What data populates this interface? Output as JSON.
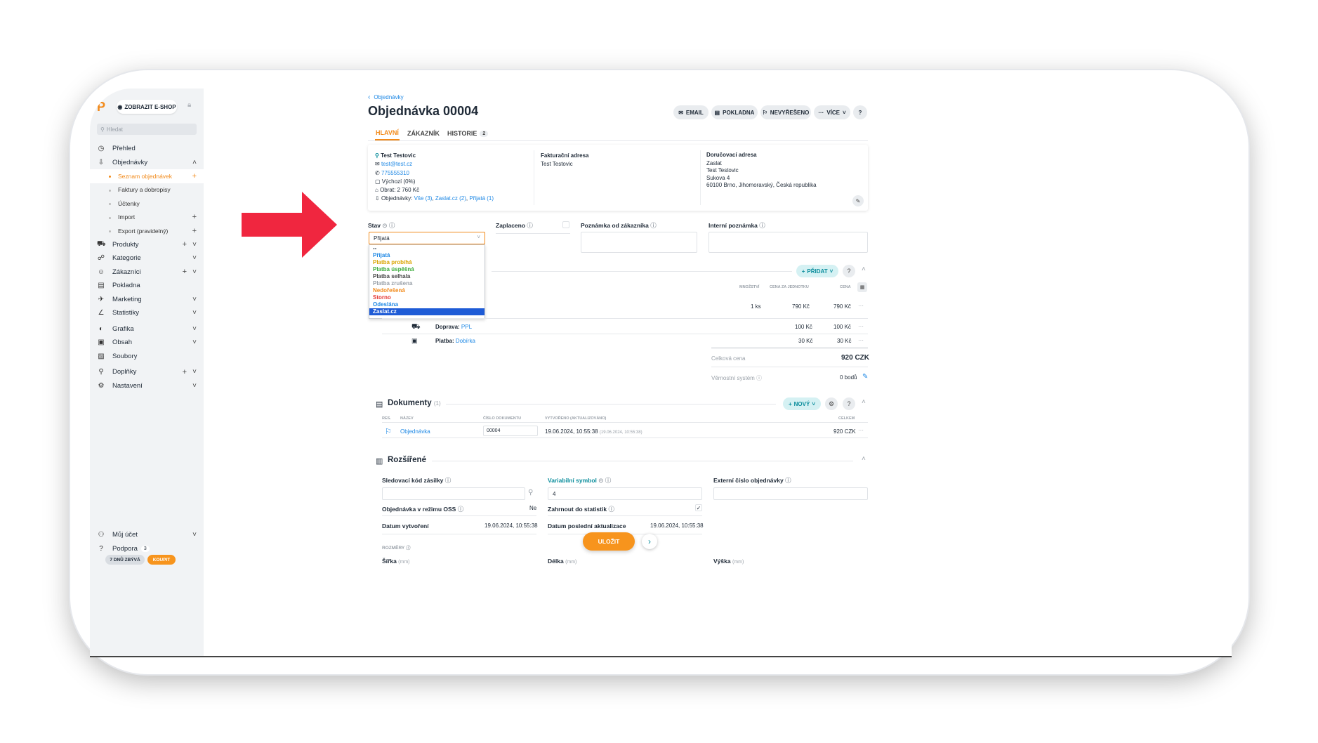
{
  "sidebar": {
    "logo": "P",
    "eshop_button": "ZOBRAZIT E-SHOP",
    "search_placeholder": "Hledat",
    "items": [
      {
        "icon": "dashboard-icon",
        "glyph": "◷",
        "label": "Přehled"
      },
      {
        "icon": "orders-icon",
        "glyph": "⇩",
        "label": "Objednávky",
        "chevron": "˄"
      },
      {
        "icon": "products-icon",
        "glyph": "⛟",
        "label": "Produkty",
        "plus": "+",
        "chevron": "˅"
      },
      {
        "icon": "categories-icon",
        "glyph": "☍",
        "label": "Kategorie",
        "chevron": "˅"
      },
      {
        "icon": "customers-icon",
        "glyph": "☺",
        "label": "Zákazníci",
        "plus": "+",
        "chevron": "˅"
      },
      {
        "icon": "cash-register-icon",
        "glyph": "▤",
        "label": "Pokladna"
      },
      {
        "icon": "marketing-icon",
        "glyph": "✈",
        "label": "Marketing",
        "chevron": "˅"
      },
      {
        "icon": "statistics-icon",
        "glyph": "∠",
        "label": "Statistiky",
        "chevron": "˅"
      },
      {
        "icon": "graphics-icon",
        "glyph": "◐",
        "label": "Grafika",
        "chevron": "˅"
      },
      {
        "icon": "content-icon",
        "glyph": "▣",
        "label": "Obsah",
        "chevron": "˅"
      },
      {
        "icon": "files-icon",
        "glyph": "▨",
        "label": "Soubory"
      },
      {
        "icon": "addons-icon",
        "glyph": "⚲",
        "label": "Doplňky",
        "plus": "+",
        "chevron": "˅"
      },
      {
        "icon": "settings-icon",
        "glyph": "⚙",
        "label": "Nastavení",
        "chevron": "˅"
      }
    ],
    "sub_items": [
      {
        "label": "Seznam objednávek",
        "plus": "+"
      },
      {
        "label": "Faktury a dobropisy"
      },
      {
        "label": "Účtenky"
      },
      {
        "label": "Import",
        "plus": "+"
      },
      {
        "label": "Export (pravidelný)",
        "plus": "+"
      }
    ],
    "account": {
      "label": "Můj účet",
      "chevron": "˅"
    },
    "support": {
      "label": "Podpora",
      "count": "3"
    },
    "days_left": "7 DNŮ ZBÝVÁ",
    "buy": "KOUPIT"
  },
  "header": {
    "breadcrumb": "Objednávky",
    "title": "Objednávka 00004",
    "buttons": {
      "email": "EMAIL",
      "pos": "POKLADNA",
      "unresolved": "NEVYŘEŠENO",
      "more": "VÍCE",
      "help": "?"
    },
    "tabs": [
      {
        "label": "HLAVNÍ"
      },
      {
        "label": "ZÁKAZNÍK"
      },
      {
        "label": "HISTORIE",
        "count": "2"
      }
    ]
  },
  "customer": {
    "name": "Test Testovic",
    "email": "test@test.cz",
    "phone": "775555310",
    "pricelist": "Výchozí (0%)",
    "turnover": "Obrat: 2 760 Kč",
    "orders_label": "Objednávky:",
    "orders_all": "Vše (3)",
    "orders_zaslat": "Zaslat.cz (2)",
    "orders_accepted": "Přijatá (1)"
  },
  "billing": {
    "title": "Fakturační adresa",
    "name": "Test Testovic"
  },
  "shipping": {
    "title": "Doručovací adresa",
    "lines": [
      "Zaslat",
      "Test Testovic",
      "Sukova 4",
      "60100 Brno, Jihomoravský, Česká republika"
    ]
  },
  "form": {
    "status_label": "Stav",
    "status_value": "Přijatá",
    "paid_label": "Zaplaceno",
    "customer_note_label": "Poznámka od zákazníka",
    "internal_note_label": "Interní poznámka"
  },
  "status_options": [
    {
      "label": "--",
      "color": "#1f2a37"
    },
    {
      "label": "Přijatá",
      "color": "#1e88e5"
    },
    {
      "label": "Platba probíhá",
      "color": "#d9a400"
    },
    {
      "label": "Platba úspěšná",
      "color": "#3bab3b"
    },
    {
      "label": "Platba selhala",
      "color": "#444444"
    },
    {
      "label": "Platba zrušena",
      "color": "#9aa1a9"
    },
    {
      "label": "Nedořešená",
      "color": "#f28a1a"
    },
    {
      "label": "Storno",
      "color": "#e53935"
    },
    {
      "label": "Odeslána",
      "color": "#1e88e5"
    },
    {
      "label": "Zaslat.cz",
      "color": "#ffffff",
      "selected": true
    }
  ],
  "items_section": {
    "add_button": "PŘIDAT",
    "help": "?",
    "columns": {
      "qty": "MNOŽSTVÍ",
      "unit_price": "CENA ZA JEDNOTKU",
      "price": "CENA"
    },
    "product": {
      "qty": "1 ks",
      "unit_price": "790 Kč",
      "price": "790 Kč"
    },
    "shipping": {
      "label": "Doprava:",
      "value": "PPL",
      "unit_price": "100 Kč",
      "price": "100 Kč"
    },
    "payment": {
      "label": "Platba:",
      "value": "Dobírka",
      "unit_price": "30 Kč",
      "price": "30 Kč"
    },
    "total_label": "Celková cena",
    "total_value": "920 CZK",
    "loyalty_label": "Věrnostní systém",
    "loyalty_value": "0 bodů",
    "more": "···"
  },
  "documents": {
    "title": "Dokumenty",
    "count": "(1)",
    "new_button": "NOVÝ",
    "help": "?",
    "columns": {
      "res": "RES.",
      "name": "NÁZEV",
      "doc_no": "ČÍSLO DOKUMENTU",
      "created": "VYTVOŘENO (AKTUALIZOVÁNO)",
      "total": "CELKEM"
    },
    "row": {
      "name": "Objednávka",
      "doc_no": "00004",
      "created": "19.06.2024, 10:55:38",
      "updated": "(19.06.2024, 10:55:38)",
      "total": "920 CZK",
      "more": "···"
    }
  },
  "extended": {
    "title": "Rozšířené",
    "tracking_label": "Sledovací kód zásilky",
    "variable_symbol_label": "Variabilní symbol",
    "variable_symbol_value": "4",
    "external_no_label": "Externí číslo objednávky",
    "oss_label": "Objednávka v režimu OSS",
    "oss_value": "Ne",
    "stats_label": "Zahrnout do statistik",
    "created_label": "Datum vytvoření",
    "created_value": "19.06.2024, 10:55:38",
    "updated_label": "Datum poslední aktualizace",
    "updated_value": "19.06.2024, 10:55:38",
    "dimensions_label": "ROZMĚRY",
    "width_label": "Šířka",
    "length_label": "Délka",
    "height_label": "Výška",
    "unit": "(mm)"
  },
  "save_button": "ULOŽIT",
  "colors": {
    "accent": "#f28a1a",
    "link": "#1e88e5",
    "arrow": "#f0263f",
    "teal": "#0a8d9c"
  }
}
